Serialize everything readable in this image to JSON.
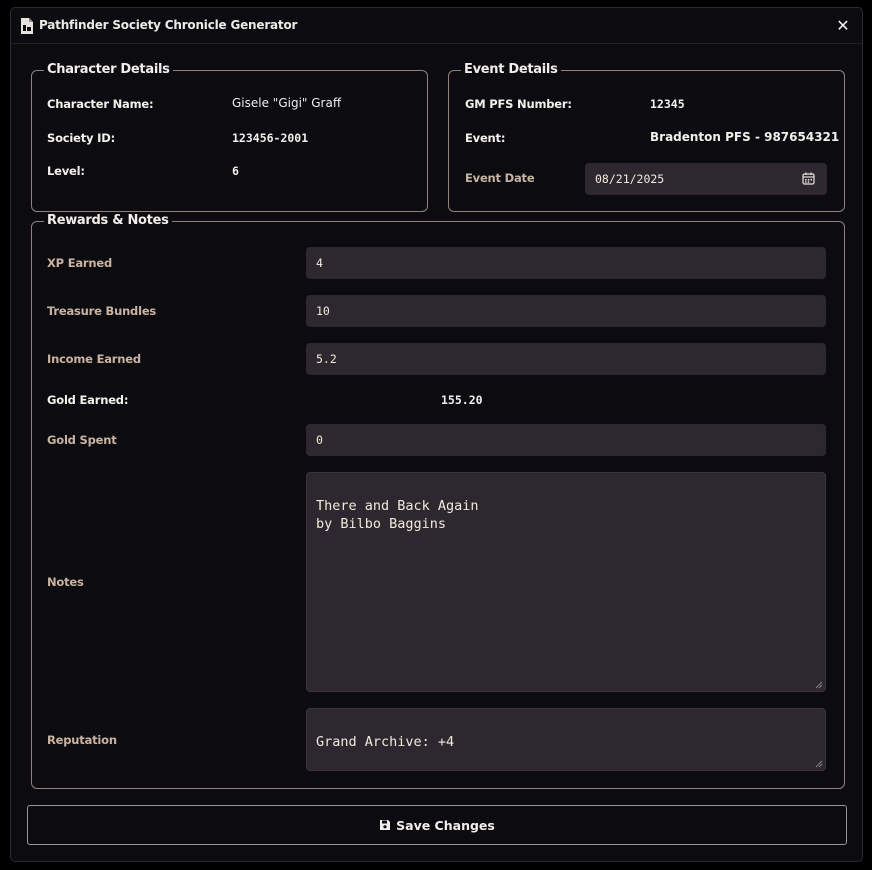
{
  "window": {
    "title": "Pathfinder Society Chronicle Generator",
    "close_glyph": "✕"
  },
  "character": {
    "legend": "Character Details",
    "name_label": "Character Name:",
    "name_value": "Gisele \"Gigi\" Graff",
    "society_label": "Society ID:",
    "society_value": "123456-2001",
    "level_label": "Level:",
    "level_value": "6"
  },
  "event": {
    "legend": "Event Details",
    "gm_label": "GM PFS Number:",
    "gm_value": "12345",
    "event_label": "Event:",
    "event_value": "Bradenton PFS - 987654321",
    "date_label": "Event Date",
    "date_value": "08/21/2025"
  },
  "rewards": {
    "legend": "Rewards & Notes",
    "xp_label": "XP Earned",
    "xp_value": "4",
    "treasure_label": "Treasure Bundles",
    "treasure_value": "10",
    "income_label": "Income Earned",
    "income_value": "5.2",
    "gold_earned_label": "Gold Earned:",
    "gold_earned_value": "155.20",
    "gold_spent_label": "Gold Spent",
    "gold_spent_value": "0",
    "notes_label": "Notes",
    "notes_value": "There and Back Again\nby Bilbo Baggins",
    "reputation_label": "Reputation",
    "reputation_value": "Grand Archive: +4"
  },
  "actions": {
    "save_label": "Save Changes"
  },
  "icons": {
    "title": "document-icon",
    "close": "close-icon",
    "calendar": "calendar-icon",
    "save": "floppy-disk-icon"
  },
  "colors": {
    "background": "#0c0b10",
    "input_bg": "#2d282f",
    "border": "#8f8379",
    "muted_label": "#c9b4a2"
  }
}
